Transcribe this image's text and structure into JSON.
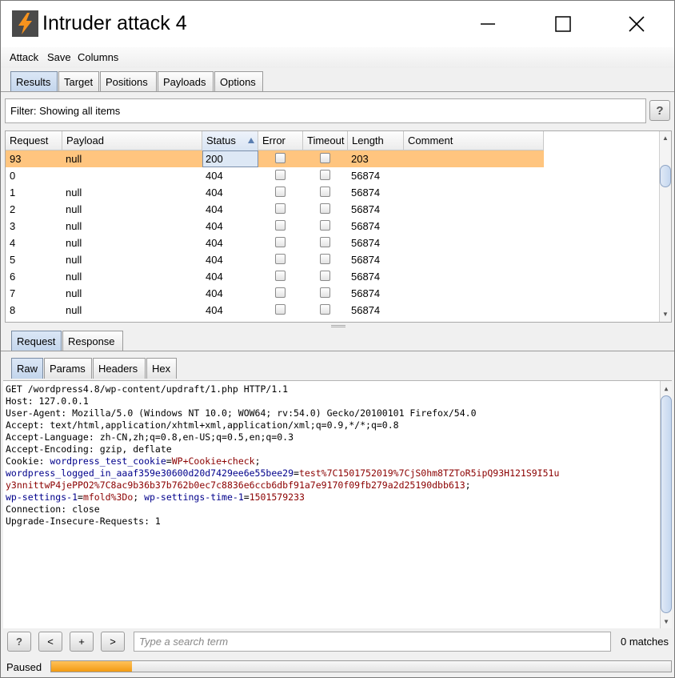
{
  "window": {
    "title": "Intruder attack 4",
    "controls": [
      "minimize",
      "maximize",
      "close"
    ]
  },
  "menu": [
    "Attack",
    "Save",
    "Columns"
  ],
  "main_tabs": [
    {
      "label": "Results",
      "active": true
    },
    {
      "label": "Target",
      "active": false
    },
    {
      "label": "Positions",
      "active": false
    },
    {
      "label": "Payloads",
      "active": false
    },
    {
      "label": "Options",
      "active": false
    }
  ],
  "filter": {
    "text": "Filter: Showing all items",
    "help": "?"
  },
  "results_table": {
    "columns": [
      "Request",
      "Payload",
      "Status",
      "Error",
      "Timeout",
      "Length",
      "Comment"
    ],
    "sorted_column": "Status",
    "rows": [
      {
        "request": "93",
        "payload": "null",
        "status": "200",
        "error": false,
        "timeout": false,
        "length": "203",
        "comment": "",
        "selected": true
      },
      {
        "request": "0",
        "payload": "",
        "status": "404",
        "error": false,
        "timeout": false,
        "length": "56874",
        "comment": ""
      },
      {
        "request": "1",
        "payload": "null",
        "status": "404",
        "error": false,
        "timeout": false,
        "length": "56874",
        "comment": ""
      },
      {
        "request": "2",
        "payload": "null",
        "status": "404",
        "error": false,
        "timeout": false,
        "length": "56874",
        "comment": ""
      },
      {
        "request": "3",
        "payload": "null",
        "status": "404",
        "error": false,
        "timeout": false,
        "length": "56874",
        "comment": ""
      },
      {
        "request": "4",
        "payload": "null",
        "status": "404",
        "error": false,
        "timeout": false,
        "length": "56874",
        "comment": ""
      },
      {
        "request": "5",
        "payload": "null",
        "status": "404",
        "error": false,
        "timeout": false,
        "length": "56874",
        "comment": ""
      },
      {
        "request": "6",
        "payload": "null",
        "status": "404",
        "error": false,
        "timeout": false,
        "length": "56874",
        "comment": ""
      },
      {
        "request": "7",
        "payload": "null",
        "status": "404",
        "error": false,
        "timeout": false,
        "length": "56874",
        "comment": ""
      },
      {
        "request": "8",
        "payload": "null",
        "status": "404",
        "error": false,
        "timeout": false,
        "length": "56874",
        "comment": ""
      }
    ]
  },
  "detail_tabs": [
    {
      "label": "Request",
      "active": true
    },
    {
      "label": "Response",
      "active": false
    }
  ],
  "view_tabs": [
    {
      "label": "Raw",
      "active": true
    },
    {
      "label": "Params",
      "active": false
    },
    {
      "label": "Headers",
      "active": false
    },
    {
      "label": "Hex",
      "active": false
    }
  ],
  "raw_request": {
    "request_line": "GET /wordpress4.8/wp-content/updraft/1.php HTTP/1.1",
    "host": "Host: 127.0.0.1",
    "user_agent": "User-Agent: Mozilla/5.0 (Windows NT 10.0; WOW64; rv:54.0) Gecko/20100101 Firefox/54.0",
    "accept": "Accept: text/html,application/xhtml+xml,application/xml;q=0.9,*/*;q=0.8",
    "accept_language": "Accept-Language: zh-CN,zh;q=0.8,en-US;q=0.5,en;q=0.3",
    "accept_encoding": "Accept-Encoding: gzip, deflate",
    "cookie_prefix": "Cookie: ",
    "cookie1_name": "wordpress_test_cookie",
    "cookie1_value": "WP+Cookie+check",
    "cookie2_name": "wordpress_logged_in_aaaf359e30600d20d7429ee6e55bee29",
    "cookie2_value_part1": "test%7C1501752019%7CjS0hm8TZToR5ipQ93H121S9I51u",
    "cookie2_value_part2": "y3nnittwP4jePPO2%7C8ac9b36b37b762b0ec7c8836e6ccb6dbf91a7e9170f09fb279a2d25190dbb613",
    "cookie3_name": "wp-settings-1",
    "cookie3_value": "mfold%3Do",
    "cookie4_name": "wp-settings-time-1",
    "cookie4_value": "1501579233",
    "connection": "Connection: close",
    "upgrade": "Upgrade-Insecure-Requests: 1"
  },
  "search": {
    "help": "?",
    "prev": "<",
    "add": "+",
    "next": ">",
    "placeholder": "Type a search term",
    "matches": "0 matches"
  },
  "status": {
    "text": "Paused",
    "progress": 0.13
  },
  "colors": {
    "selected_row": "#ffc57f",
    "header_name": "#00008b",
    "cookie_value": "#8b0000",
    "progress": "#f39a12",
    "logo": "#f7931e"
  }
}
